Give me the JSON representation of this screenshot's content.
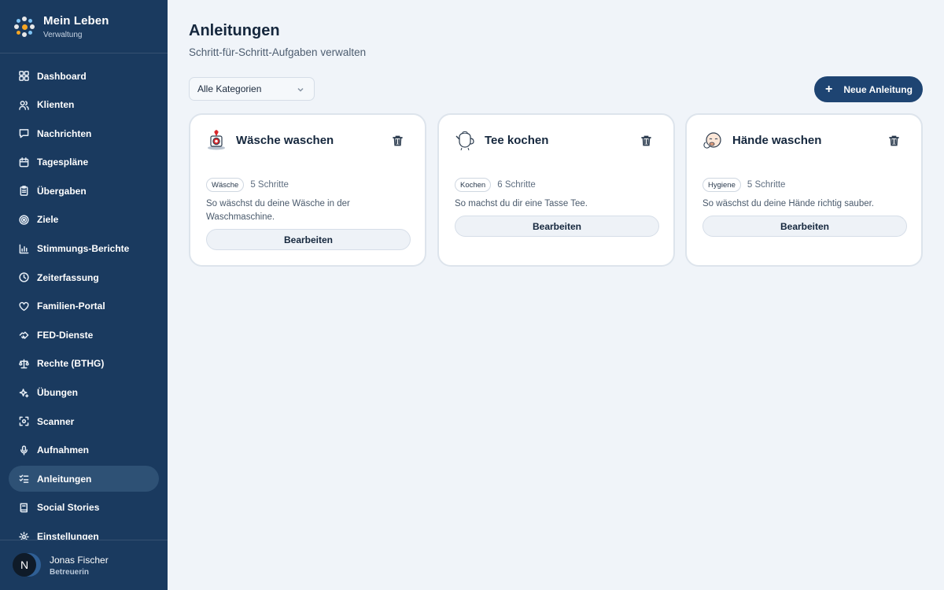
{
  "brand": {
    "title": "Mein Leben",
    "subtitle": "Verwaltung"
  },
  "sidebar": {
    "items": [
      {
        "label": "Dashboard",
        "icon": "grid-icon"
      },
      {
        "label": "Klienten",
        "icon": "users-icon"
      },
      {
        "label": "Nachrichten",
        "icon": "message-icon"
      },
      {
        "label": "Tagespläne",
        "icon": "calendar-icon"
      },
      {
        "label": "Übergaben",
        "icon": "clipboard-icon"
      },
      {
        "label": "Ziele",
        "icon": "target-icon"
      },
      {
        "label": "Stimmungs-Berichte",
        "icon": "bar-chart-icon"
      },
      {
        "label": "Zeiterfassung",
        "icon": "clock-icon"
      },
      {
        "label": "Familien-Portal",
        "icon": "heart-icon"
      },
      {
        "label": "FED-Dienste",
        "icon": "handshake-icon"
      },
      {
        "label": "Rechte (BTHG)",
        "icon": "scale-icon"
      },
      {
        "label": "Übungen",
        "icon": "sparkles-icon"
      },
      {
        "label": "Scanner",
        "icon": "scan-icon"
      },
      {
        "label": "Aufnahmen",
        "icon": "microphone-icon"
      },
      {
        "label": "Anleitungen",
        "icon": "list-checks-icon",
        "active": true
      },
      {
        "label": "Social Stories",
        "icon": "book-icon"
      },
      {
        "label": "Einstellungen",
        "icon": "gear-icon"
      }
    ]
  },
  "user": {
    "initial": "N",
    "name": "Jonas Fischer",
    "role": "Betreuerin"
  },
  "page": {
    "title": "Anleitungen",
    "subtitle": "Schritt-für-Schritt-Aufgaben verwalten"
  },
  "filter": {
    "selected": "Alle Kategorien"
  },
  "new_button": {
    "label": "Neue Anleitung"
  },
  "cards": [
    {
      "title": "Wäsche waschen",
      "tag": "Wäsche",
      "steps": "5 Schritte",
      "description": "So wäschst du deine Wäsche in der Waschmaschine.",
      "edit_label": "Bearbeiten",
      "icon": "washing-machine-icon"
    },
    {
      "title": "Tee kochen",
      "tag": "Kochen",
      "steps": "6 Schritte",
      "description": "So machst du dir eine Tasse Tee.",
      "edit_label": "Bearbeiten",
      "icon": "teapot-icon"
    },
    {
      "title": "Hände waschen",
      "tag": "Hygiene",
      "steps": "5 Schritte",
      "description": "So wäschst du deine Hände richtig sauber.",
      "edit_label": "Bearbeiten",
      "icon": "hand-wash-icon"
    }
  ],
  "colors": {
    "sidebar": "#1a3a5f",
    "accent": "#1e4472",
    "active": "#2e5175",
    "background": "#f0f4f9"
  }
}
